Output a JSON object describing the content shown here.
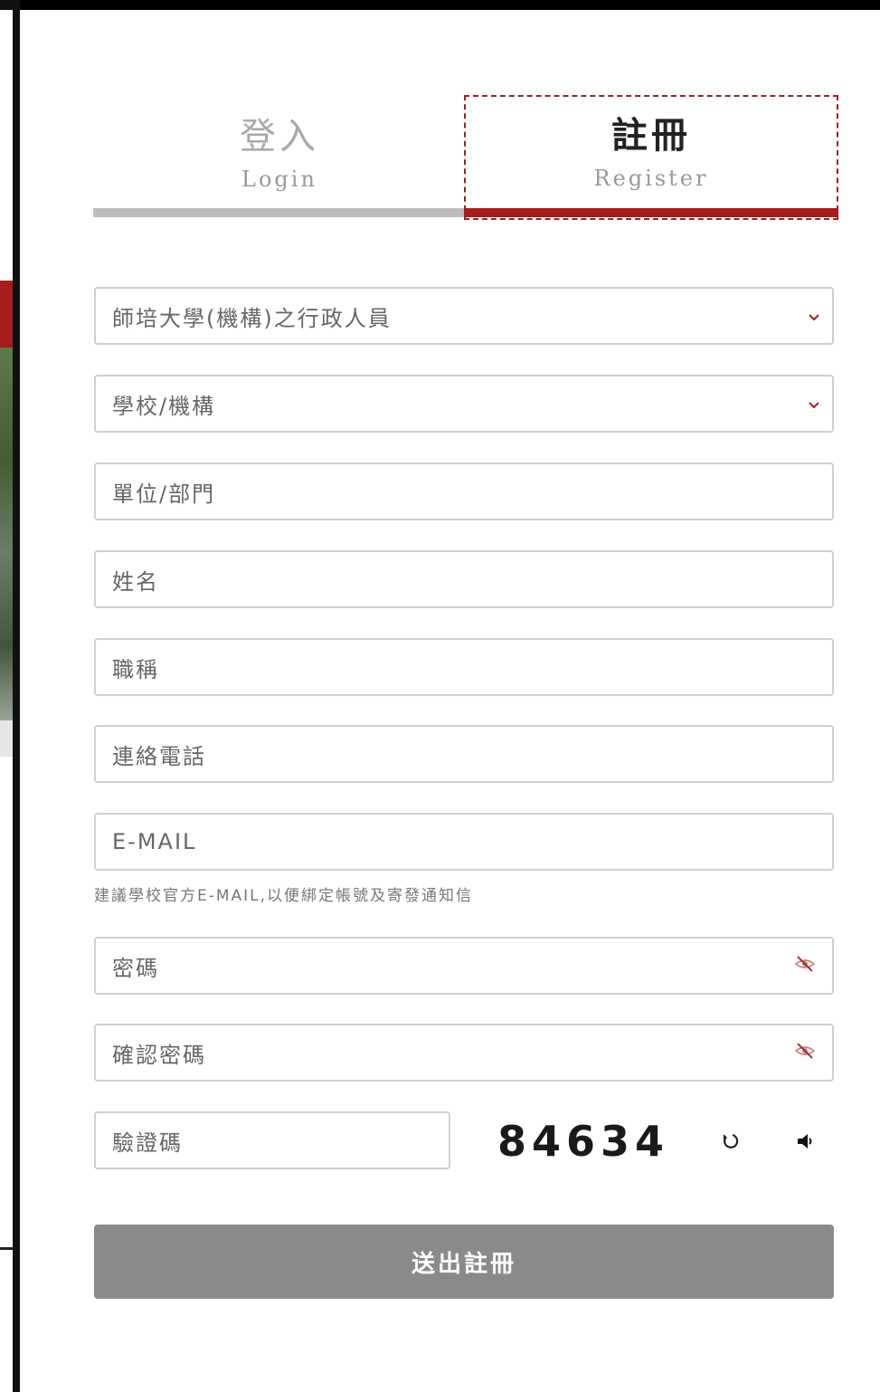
{
  "tabs": {
    "login": {
      "title": "登入",
      "subtitle": "Login"
    },
    "register": {
      "title": "註冊",
      "subtitle": "Register"
    }
  },
  "form": {
    "role_select": {
      "value": "師培大學(機構)之行政人員"
    },
    "school_select": {
      "placeholder": "學校/機構"
    },
    "department": {
      "placeholder": "單位/部門"
    },
    "name": {
      "placeholder": "姓名"
    },
    "job_title": {
      "placeholder": "職稱"
    },
    "phone": {
      "placeholder": "連絡電話"
    },
    "email": {
      "placeholder": "E-MAIL"
    },
    "email_hint": "建議學校官方E-MAIL,以便綁定帳號及寄發通知信",
    "password": {
      "placeholder": "密碼"
    },
    "confirm_password": {
      "placeholder": "確認密碼"
    },
    "captcha": {
      "placeholder": "驗證碼",
      "code": "84634"
    },
    "submit_label": "送出註冊"
  },
  "colors": {
    "accent": "#a51c1c",
    "submit_bg": "#8a8a8a",
    "inactive_tab_bar": "#bdbdbd"
  },
  "icons": {
    "select": "chevron-down-icon",
    "password_toggle": "eye-off-icon",
    "captcha_refresh": "refresh-icon",
    "captcha_audio": "speaker-icon"
  }
}
